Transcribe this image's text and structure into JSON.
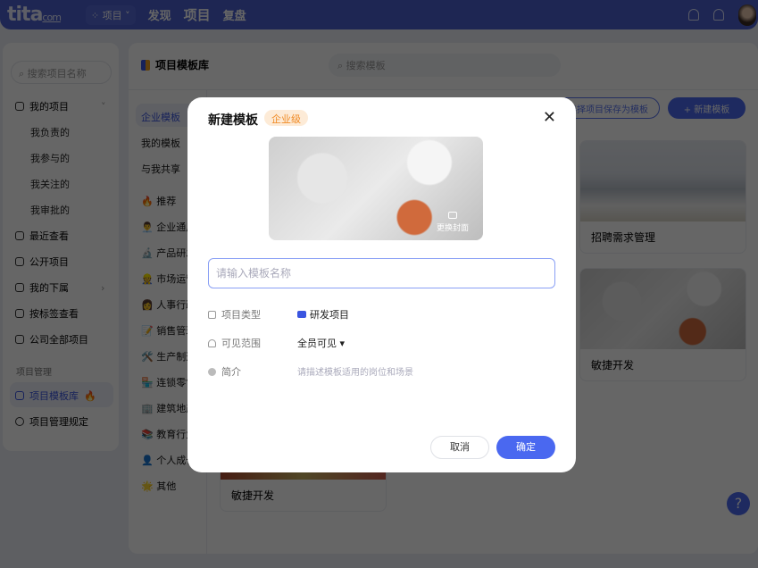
{
  "header": {
    "logo": "tita",
    "logo_suffix": "com",
    "switch_label": "项目",
    "nav": [
      "发现",
      "项目",
      "复盘"
    ]
  },
  "sidebar": {
    "search_placeholder": "搜索项目名称",
    "my_projects": "我的项目",
    "sub_items": [
      "我负责的",
      "我参与的",
      "我关注的",
      "我审批的"
    ],
    "items": [
      "最近查看",
      "公开项目",
      "我的下属",
      "按标签查看",
      "公司全部项目"
    ],
    "section_label": "项目管理",
    "template_library": "项目模板库",
    "fire": "🔥",
    "rules": "项目管理规定"
  },
  "main": {
    "title": "项目模板库",
    "search_placeholder": "搜索模板",
    "tabs": [
      "企业模板",
      "我的模板",
      "与我共享"
    ],
    "categories": [
      "🔥 推荐",
      "👨‍💼 企业通用",
      "🔬 产品研发",
      "👷 市场运营",
      "👩 人事行政",
      "📝 销售管理",
      "🛠️ 生产制造",
      "🏪 连锁零售",
      "🏢 建筑地产",
      "📚 教育行业",
      "👤 个人成长",
      "🌟 其他"
    ],
    "save_as_template": "选择项目保存为模板",
    "new_template": "+  新建模板",
    "cards": [
      "招聘需求管理",
      "敏捷开发",
      "敏捷开发"
    ],
    "help": "?"
  },
  "dialog": {
    "title": "新建模板",
    "badge": "企业级",
    "close": "✕",
    "change_cover": "更换封面",
    "name_placeholder": "请输入模板名称",
    "type_label": "项目类型",
    "type_value": "研发项目",
    "visibility_label": "可见范围",
    "visibility_value": "全员可见 ▾",
    "intro_label": "简介",
    "intro_placeholder": "请描述模板适用的岗位和场景",
    "cancel": "取消",
    "confirm": "确定"
  },
  "colors": {
    "brand": "#3a55e0",
    "badge": "#f08a24",
    "header": "#3347b0"
  }
}
